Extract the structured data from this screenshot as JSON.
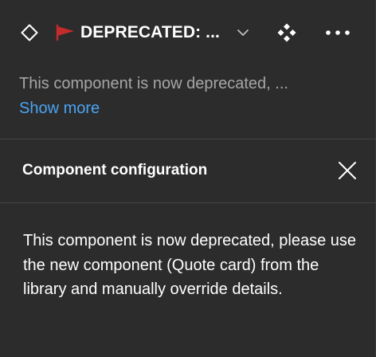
{
  "header": {
    "title": "DEPRECATED: ...",
    "component_icon": "component-outline-icon",
    "flag_icon": "red-flag-icon",
    "chevron_icon": "chevron-down-icon",
    "instance_icon": "instance-icon",
    "more_icon": "more-options-icon"
  },
  "description": {
    "text": "This component is now deprecated, ...",
    "show_more_label": "Show more"
  },
  "config": {
    "title": "Component configuration",
    "body": "This component is now deprecated, please use the new component (Quote card) from the library and manually override details.",
    "close_icon": "close-icon"
  },
  "colors": {
    "background": "#2c2c2c",
    "divider": "#444444",
    "link": "#4aa4f3",
    "muted_text": "#a6a6a6",
    "flag": "#c42b2b"
  }
}
